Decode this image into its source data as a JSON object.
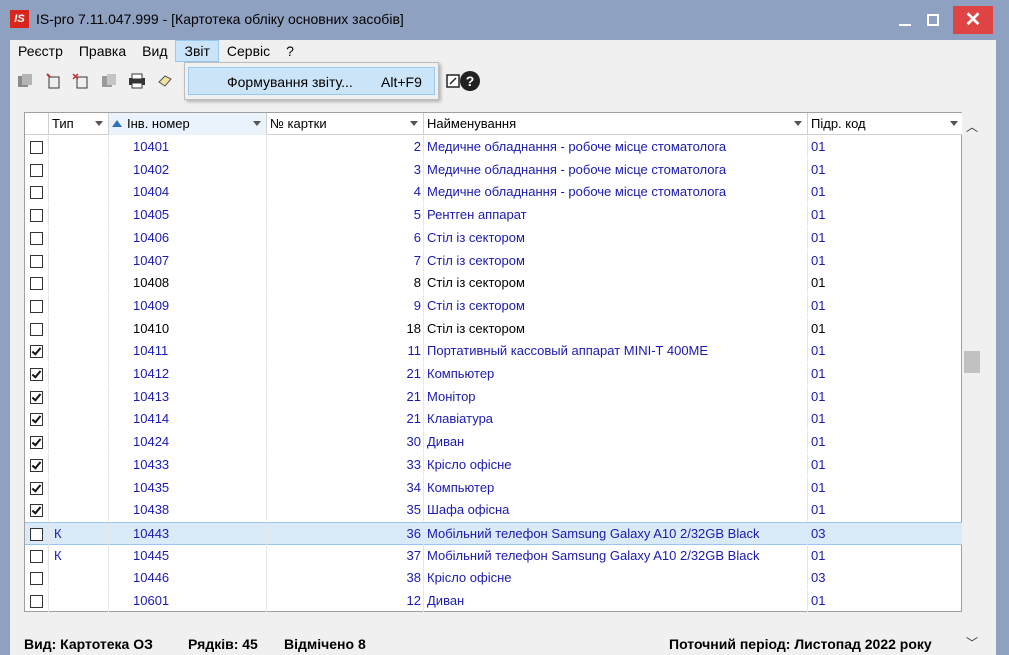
{
  "window": {
    "logo": "IS",
    "title": "IS-pro 7.11.047.999 - [Картотека обліку основних засобів]"
  },
  "menu": [
    "Реєстр",
    "Правка",
    "Вид",
    "Звіт",
    "Сервіс",
    "?"
  ],
  "active_menu": "Звіт",
  "dropdown": {
    "item_label": "Формування звіту...",
    "item_shortcut": "Alt+F9"
  },
  "toolbar_icons": [
    "create-icon",
    "add-icon",
    "delete-icon",
    "copy-icon",
    "print-icon",
    "settings-icon",
    "calendar-icon",
    "help-icon"
  ],
  "help_glyph": "?",
  "columns": {
    "type": "Тип",
    "inv": "Інв. номер",
    "card": "№ картки",
    "name": "Найменування",
    "dep": "Підр. код"
  },
  "rows": [
    {
      "checked": false,
      "type": "",
      "inv": "10401",
      "card": "2",
      "name": "Медичне обладнання - робоче місце стоматолога",
      "dep": "01",
      "color": "blue"
    },
    {
      "checked": false,
      "type": "",
      "inv": "10402",
      "card": "3",
      "name": "Медичне обладнання - робоче місце стоматолога",
      "dep": "01",
      "color": "blue"
    },
    {
      "checked": false,
      "type": "",
      "inv": "10404",
      "card": "4",
      "name": "Медичне обладнання - робоче місце стоматолога",
      "dep": "01",
      "color": "blue"
    },
    {
      "checked": false,
      "type": "",
      "inv": "10405",
      "card": "5",
      "name": "Рентген аппарат",
      "dep": "01",
      "color": "blue"
    },
    {
      "checked": false,
      "type": "",
      "inv": "10406",
      "card": "6",
      "name": "Стіл із сектором",
      "dep": "01",
      "color": "blue"
    },
    {
      "checked": false,
      "type": "",
      "inv": "10407",
      "card": "7",
      "name": "Стіл із сектором",
      "dep": "01",
      "color": "blue"
    },
    {
      "checked": false,
      "type": "",
      "inv": "10408",
      "card": "8",
      "name": "Стіл із сектором",
      "dep": "01",
      "color": "black"
    },
    {
      "checked": false,
      "type": "",
      "inv": "10409",
      "card": "9",
      "name": "Стіл із сектором",
      "dep": "01",
      "color": "blue"
    },
    {
      "checked": false,
      "type": "",
      "inv": "10410",
      "card": "18",
      "name": "Стіл із сектором",
      "dep": "01",
      "color": "black"
    },
    {
      "checked": true,
      "type": "",
      "inv": "10411",
      "card": "11",
      "name": "Портативный кассовый аппарат MINI-T 400ME",
      "dep": "01",
      "color": "blue"
    },
    {
      "checked": true,
      "type": "",
      "inv": "10412",
      "card": "21",
      "name": "Компьютер",
      "dep": "01",
      "color": "blue"
    },
    {
      "checked": true,
      "type": "",
      "inv": "10413",
      "card": "21",
      "name": "Монітор",
      "dep": "01",
      "color": "blue"
    },
    {
      "checked": true,
      "type": "",
      "inv": "10414",
      "card": "21",
      "name": "Клавіатура",
      "dep": "01",
      "color": "blue"
    },
    {
      "checked": true,
      "type": "",
      "inv": "10424",
      "card": "30",
      "name": "Диван",
      "dep": "01",
      "color": "blue"
    },
    {
      "checked": true,
      "type": "",
      "inv": "10433",
      "card": "33",
      "name": "Крісло офісне",
      "dep": "01",
      "color": "blue"
    },
    {
      "checked": true,
      "type": "",
      "inv": "10435",
      "card": "34",
      "name": "Компьютер",
      "dep": "01",
      "color": "blue"
    },
    {
      "checked": true,
      "type": "",
      "inv": "10438",
      "card": "35",
      "name": "Шафа офісна",
      "dep": "01",
      "color": "blue"
    },
    {
      "checked": false,
      "type": "К",
      "inv": "10443",
      "card": "36",
      "name": "Мобільний телефон Samsung Galaxy A10 2/32GB Black",
      "dep": "03",
      "color": "blue",
      "selected": true
    },
    {
      "checked": false,
      "type": "К",
      "inv": "10445",
      "card": "37",
      "name": "Мобільний телефон Samsung Galaxy A10 2/32GB Black",
      "dep": "01",
      "color": "blue"
    },
    {
      "checked": false,
      "type": "",
      "inv": "10446",
      "card": "38",
      "name": "Крісло офісне",
      "dep": "03",
      "color": "blue"
    },
    {
      "checked": false,
      "type": "",
      "inv": "10601",
      "card": "12",
      "name": "Диван",
      "dep": "01",
      "color": "blue"
    }
  ],
  "status": {
    "view": "Вид: Картотека ОЗ",
    "rows": "Рядків: 45",
    "marked": "Відмічено 8",
    "period": "Поточний період: Листопад 2022 року"
  },
  "colors": {
    "title_bar": "#8fa1c1",
    "close_button": "#e04343",
    "link_text": "#1a1ab0",
    "selection": "#dbeaf9",
    "menu_highlight": "#cce4f7"
  }
}
